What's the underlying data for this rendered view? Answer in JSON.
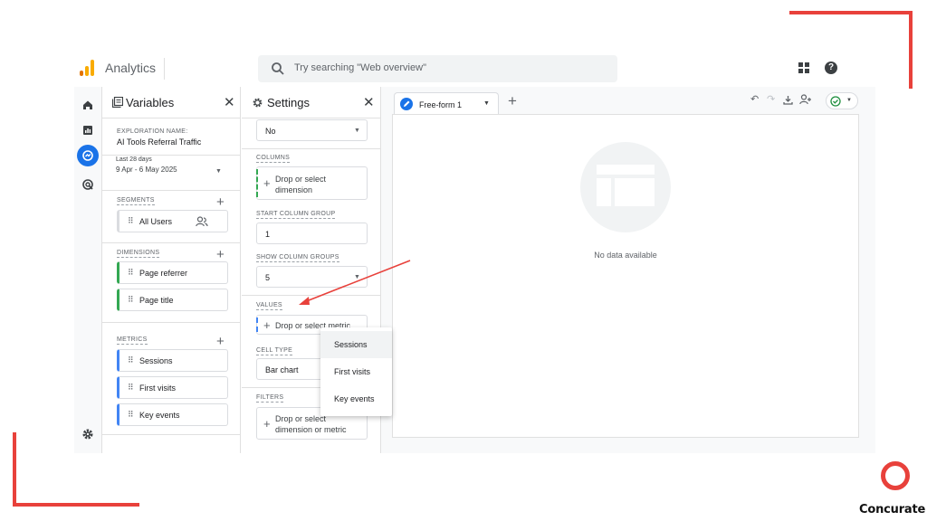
{
  "app": {
    "title": "Analytics",
    "search_placeholder": "Try searching \"Web overview\""
  },
  "topbar": {
    "icons": [
      "apps-icon",
      "help-icon"
    ]
  },
  "rail": {
    "items": [
      "home-icon",
      "reports-icon",
      "explore-icon",
      "advertising-icon"
    ],
    "bottom": "settings-icon"
  },
  "variables": {
    "title": "Variables",
    "exploration_label": "EXPLORATION NAME:",
    "exploration_name": "AI Tools Referral Traffic",
    "date_label": "Last 28 days",
    "date_range": "9 Apr - 6 May 2025",
    "segments_label": "SEGMENTS",
    "segments": [
      "All Users"
    ],
    "dimensions_label": "DIMENSIONS",
    "dimensions": [
      "Page referrer",
      "Page title"
    ],
    "metrics_label": "METRICS",
    "metrics": [
      "Sessions",
      "First visits",
      "Key events"
    ]
  },
  "settings": {
    "title": "Settings",
    "top_value": "No",
    "columns_label": "COLUMNS",
    "columns_drop": "Drop or select dimension",
    "start_group_label": "START COLUMN GROUP",
    "start_group_value": "1",
    "show_groups_label": "SHOW COLUMN GROUPS",
    "show_groups_value": "5",
    "values_label": "VALUES",
    "values_drop": "Drop or select metric",
    "cell_type_label": "CELL TYPE",
    "cell_type_value": "Bar chart",
    "filters_label": "FILTERS",
    "filters_drop_line1": "Drop or select",
    "filters_drop_line2": "dimension or metric"
  },
  "canvas": {
    "tab_label": "Free-form 1",
    "no_data": "No data available"
  },
  "menu": {
    "items": [
      "Sessions",
      "First visits",
      "Key events"
    ]
  },
  "brand": {
    "name": "Concurate"
  },
  "colors": {
    "accent": "#1a73e8",
    "deco_red": "#e8413b",
    "dimension_green": "#34a853",
    "metric_blue": "#4285f4"
  }
}
